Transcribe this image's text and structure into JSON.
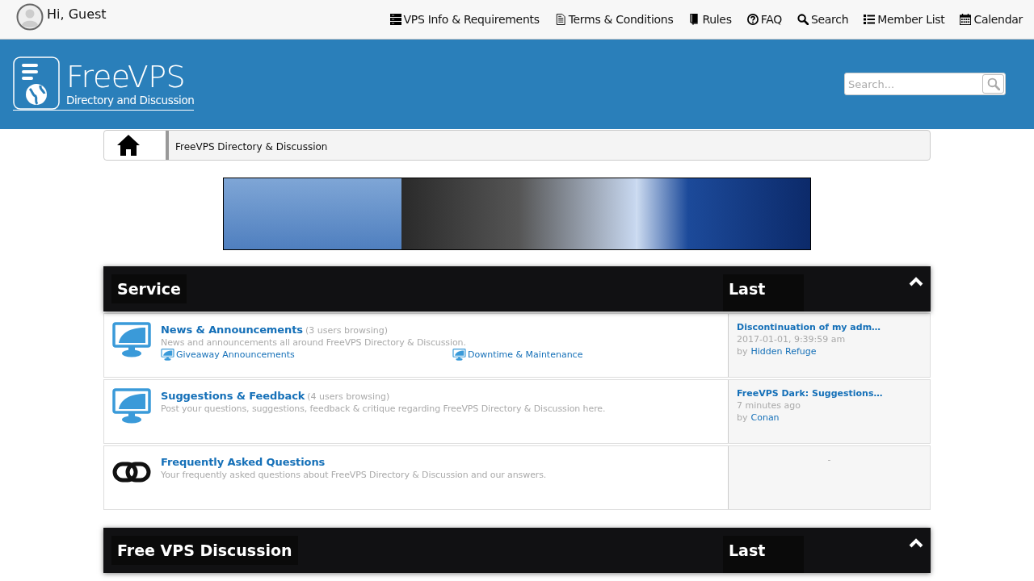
{
  "user": {
    "greeting": "Hi, Guest"
  },
  "nav": [
    {
      "kind": "server",
      "label": "VPS Info & Requirements"
    },
    {
      "kind": "document",
      "label": "Terms & Conditions"
    },
    {
      "kind": "book",
      "label": "Rules"
    },
    {
      "kind": "question",
      "label": "FAQ"
    },
    {
      "kind": "search",
      "label": "Search"
    },
    {
      "kind": "list",
      "label": "Member List"
    },
    {
      "kind": "calendar",
      "label": "Calendar"
    }
  ],
  "logo": {
    "name": "FreeVPS",
    "tagline": "Directory and Discussion"
  },
  "search": {
    "placeholder": "Search..."
  },
  "breadcrumb": [
    "FreeVPS Directory & Discussion"
  ],
  "categories": [
    {
      "title": "Service",
      "last_post_heading": "Last",
      "expanded": true,
      "forums": [
        {
          "kind": "monitor",
          "title": "News & Announcements",
          "browsing": "(3 users browsing)",
          "description": "News and announcements all around FreeVPS Directory & Discussion.",
          "subforums": [
            "Giveaway Announcements",
            "Downtime & Maintenance"
          ],
          "last_post": {
            "title": "Discontinuation of my adm…",
            "time": "2017-01-01, 9:39:59 am",
            "by": "by",
            "author": "Hidden Refuge"
          }
        },
        {
          "kind": "monitor",
          "title": "Suggestions & Feedback",
          "browsing": "(4 users browsing)",
          "description": "Post your questions, suggestions, feedback & critique regarding FreeVPS Directory & Discussion here.",
          "last_post": {
            "title": "FreeVPS Dark: Suggestions…",
            "time": "7 minutes ago",
            "by": "by",
            "author": "Conan"
          }
        },
        {
          "kind": "link",
          "title": "Frequently Asked Questions",
          "description": "Your frequently asked questions about FreeVPS Directory & Discussion and our answers.",
          "last_post_empty": "-"
        }
      ]
    },
    {
      "title": "Free VPS Discussion",
      "last_post_heading": "Last",
      "expanded": true
    }
  ]
}
